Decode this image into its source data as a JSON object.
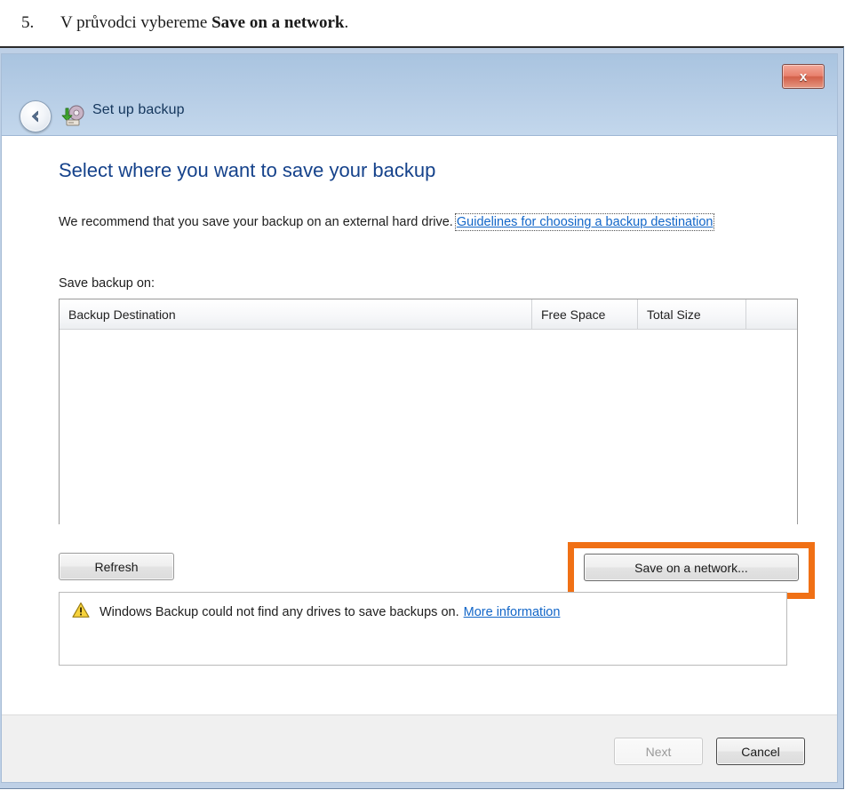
{
  "instruction": {
    "number": "5.",
    "prefix": "V průvodci vybereme ",
    "bold": "Save on a network",
    "suffix": "."
  },
  "window": {
    "title": "Set up backup",
    "app_icon": "backup-drive-icon",
    "back_icon": "back-arrow-icon",
    "close_icon": "close-icon",
    "close_label": "x"
  },
  "content": {
    "heading": "Select where you want to save your backup",
    "description_text": "We recommend that you save your backup on an external hard drive.",
    "description_link": "Guidelines for choosing a backup destination",
    "save_label": "Save backup on:"
  },
  "listview": {
    "columns": [
      {
        "label": "Backup Destination"
      },
      {
        "label": "Free Space"
      },
      {
        "label": "Total Size"
      },
      {
        "label": ""
      }
    ],
    "rows": []
  },
  "actions": {
    "refresh_label": "Refresh",
    "network_label": "Save on a network...",
    "highlight_color": "#f07015"
  },
  "warning": {
    "icon": "warning-triangle-icon",
    "message": "Windows Backup could not find any drives to save backups on.",
    "link": "More information"
  },
  "footer": {
    "next_label": "Next",
    "cancel_label": "Cancel"
  }
}
